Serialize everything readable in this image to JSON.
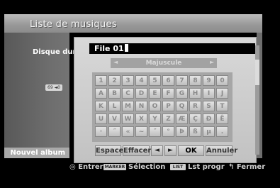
{
  "header": {
    "title": "Liste de musiques"
  },
  "sidebar": {
    "disk_label": "Disque dur",
    "new_album_label": "Nouvel album",
    "small_icon_text": "69 ◄0"
  },
  "dialog": {
    "name_value": "File 01",
    "mode_label": "Majuscule",
    "keys": [
      [
        "1",
        "2",
        "3",
        "4",
        "5",
        "6",
        "7",
        "8",
        "9",
        "0"
      ],
      [
        "A",
        "B",
        "C",
        "D",
        "E",
        "F",
        "G",
        "H",
        "I",
        "J"
      ],
      [
        "K",
        "L",
        "M",
        "N",
        "O",
        "P",
        "Q",
        "R",
        "S",
        "T"
      ],
      [
        "U",
        "V",
        "W",
        "X",
        "Y",
        "Z",
        "Æ",
        "Ç",
        "Ð",
        "Ê"
      ],
      [
        "·",
        "˝",
        "«",
        "~",
        "˝",
        "°",
        "Þ",
        "ß",
        "μ",
        "."
      ]
    ],
    "buttons": {
      "space": "Espace",
      "delete": "Effacer",
      "left": "◄",
      "right": "►",
      "ok": "OK",
      "cancel": "Annuler"
    }
  },
  "footer": {
    "enter": "Entrer",
    "marker_badge": "MARKER",
    "selection": "Sélection",
    "list_badge": "LIST",
    "list_progr": "Lst progr",
    "close": "Fermer"
  }
}
